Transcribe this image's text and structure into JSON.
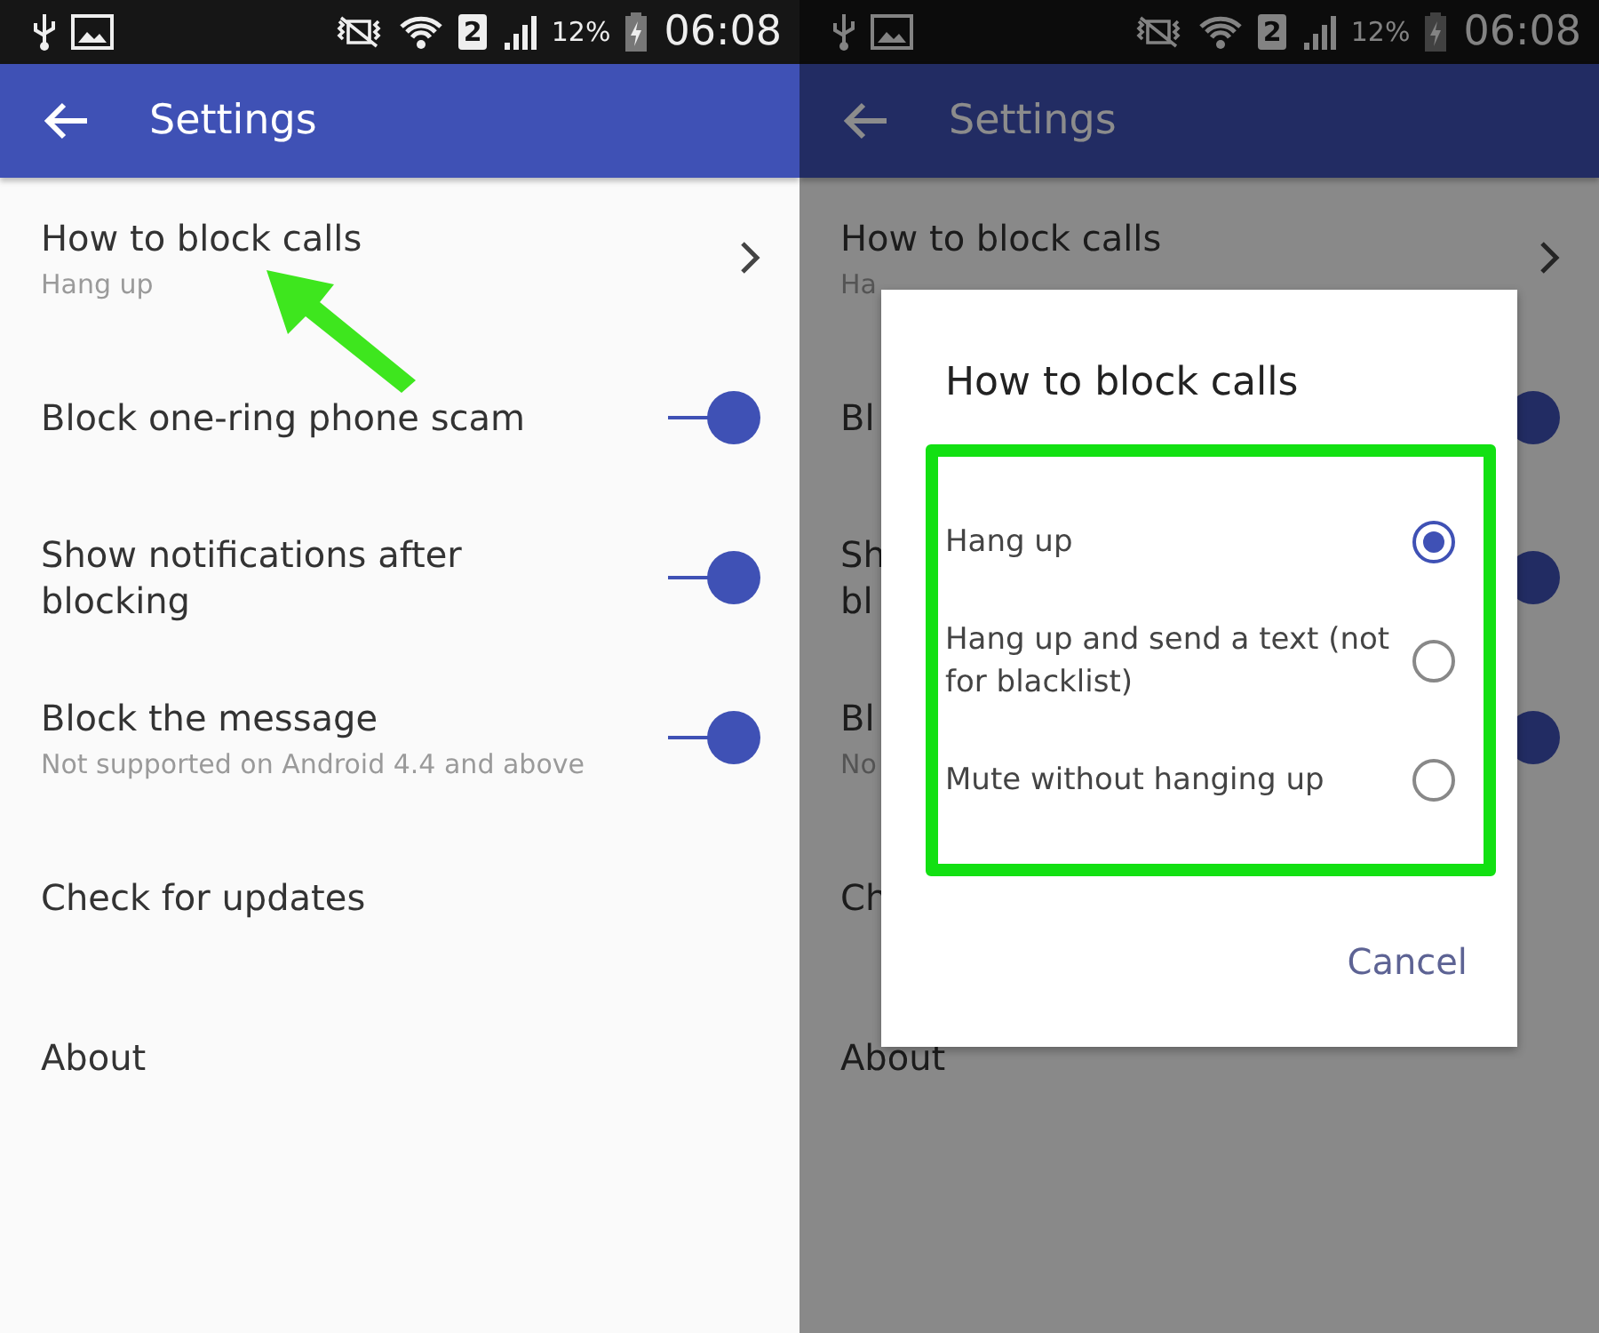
{
  "screens": [
    {
      "status_bar": {
        "sim": "2",
        "battery": "12%",
        "time": "06:08"
      },
      "toolbar": {
        "title": "Settings"
      },
      "dimmed": false,
      "annotation_arrow": true,
      "settings": [
        {
          "kind": "link",
          "title": "How to block calls",
          "summary": "Hang up"
        },
        {
          "kind": "switch",
          "title": "Block one-ring phone scam",
          "on": true
        },
        {
          "kind": "switch",
          "title": "Show notifications after blocking",
          "on": true
        },
        {
          "kind": "switch",
          "title": "Block the message",
          "summary": "Not supported on Android 4.4 and above",
          "on": true
        },
        {
          "kind": "plain",
          "title": "Check for updates"
        },
        {
          "kind": "plain",
          "title": "About"
        }
      ]
    },
    {
      "status_bar": {
        "sim": "2",
        "battery": "12%",
        "time": "06:08"
      },
      "toolbar": {
        "title": "Settings"
      },
      "dimmed": true,
      "annotation_arrow": false,
      "settings": [
        {
          "kind": "link",
          "title": "How to block calls",
          "summary": "Ha"
        },
        {
          "kind": "switch",
          "title": "Bl",
          "on": true
        },
        {
          "kind": "switch",
          "title": "Sh\nbl",
          "on": true
        },
        {
          "kind": "switch",
          "title": "Bl",
          "summary": "No",
          "on": true
        },
        {
          "kind": "plain",
          "title": "Ch"
        },
        {
          "kind": "plain",
          "title": "About"
        }
      ],
      "dialog": {
        "title": "How to block calls",
        "highlighted": true,
        "options": [
          {
            "label": "Hang up",
            "selected": true
          },
          {
            "label": "Hang up and send a text (not for blacklist)",
            "selected": false
          },
          {
            "label": "Mute without hanging up",
            "selected": false
          }
        ],
        "button": "Cancel"
      }
    }
  ]
}
